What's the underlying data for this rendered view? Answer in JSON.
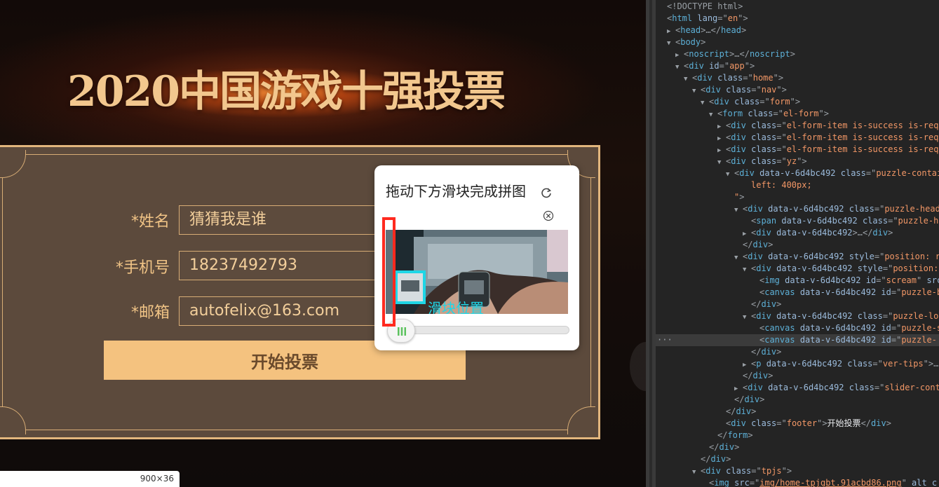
{
  "page": {
    "title": "2020中国游戏十强投票",
    "form": {
      "name_label": "*姓名",
      "name_value": "猜猜我是谁",
      "phone_label": "*手机号",
      "phone_value": "18237492793",
      "email_label": "*邮箱",
      "email_value": "autofelix@163.com",
      "submit_label": "开始投票"
    },
    "size_tip": "900×36"
  },
  "puzzle": {
    "title": "拖动下方滑块完成拼图",
    "slider_label": "滑块位置"
  },
  "devtools": {
    "lines": [
      {
        "indent": 0,
        "tri": "",
        "parts": [
          [
            "tw",
            "<!DOCTYPE html>"
          ]
        ]
      },
      {
        "indent": 0,
        "tri": "",
        "parts": [
          [
            "tw",
            "<"
          ],
          [
            "tg",
            "html"
          ],
          [
            "an",
            " lang"
          ],
          [
            "tw",
            "=\""
          ],
          [
            "av",
            "en"
          ],
          [
            "tw",
            "\">"
          ]
        ]
      },
      {
        "indent": 1,
        "tri": "▶",
        "parts": [
          [
            "tw",
            "<"
          ],
          [
            "tg",
            "head"
          ],
          [
            "tw",
            ">…</"
          ],
          [
            "tg",
            "head"
          ],
          [
            "tw",
            ">"
          ]
        ]
      },
      {
        "indent": 1,
        "tri": "▼",
        "parts": [
          [
            "tw",
            "<"
          ],
          [
            "tg",
            "body"
          ],
          [
            "tw",
            ">"
          ]
        ]
      },
      {
        "indent": 2,
        "tri": "▶",
        "parts": [
          [
            "tw",
            "<"
          ],
          [
            "tg",
            "noscript"
          ],
          [
            "tw",
            ">…</"
          ],
          [
            "tg",
            "noscript"
          ],
          [
            "tw",
            ">"
          ]
        ]
      },
      {
        "indent": 2,
        "tri": "▼",
        "parts": [
          [
            "tw",
            "<"
          ],
          [
            "tg",
            "div"
          ],
          [
            "an",
            " id"
          ],
          [
            "tw",
            "=\""
          ],
          [
            "av",
            "app"
          ],
          [
            "tw",
            "\">"
          ]
        ]
      },
      {
        "indent": 3,
        "tri": "▼",
        "parts": [
          [
            "tw",
            "<"
          ],
          [
            "tg",
            "div"
          ],
          [
            "an",
            " class"
          ],
          [
            "tw",
            "=\""
          ],
          [
            "av",
            "home"
          ],
          [
            "tw",
            "\">"
          ]
        ]
      },
      {
        "indent": 4,
        "tri": "▼",
        "parts": [
          [
            "tw",
            "<"
          ],
          [
            "tg",
            "div"
          ],
          [
            "an",
            " class"
          ],
          [
            "tw",
            "=\""
          ],
          [
            "av",
            "nav"
          ],
          [
            "tw",
            "\">"
          ]
        ]
      },
      {
        "indent": 5,
        "tri": "▼",
        "parts": [
          [
            "tw",
            "<"
          ],
          [
            "tg",
            "div"
          ],
          [
            "an",
            " class"
          ],
          [
            "tw",
            "=\""
          ],
          [
            "av",
            "form"
          ],
          [
            "tw",
            "\">"
          ]
        ]
      },
      {
        "indent": 6,
        "tri": "▼",
        "parts": [
          [
            "tw",
            "<"
          ],
          [
            "tg",
            "form"
          ],
          [
            "an",
            " class"
          ],
          [
            "tw",
            "=\""
          ],
          [
            "av",
            "el-form"
          ],
          [
            "tw",
            "\">"
          ]
        ]
      },
      {
        "indent": 7,
        "tri": "▶",
        "parts": [
          [
            "tw",
            "<"
          ],
          [
            "tg",
            "div"
          ],
          [
            "an",
            " class"
          ],
          [
            "tw",
            "=\""
          ],
          [
            "av",
            "el-form-item is-success is-req"
          ]
        ]
      },
      {
        "indent": 7,
        "tri": "▶",
        "parts": [
          [
            "tw",
            "<"
          ],
          [
            "tg",
            "div"
          ],
          [
            "an",
            " class"
          ],
          [
            "tw",
            "=\""
          ],
          [
            "av",
            "el-form-item is-success is-req"
          ]
        ]
      },
      {
        "indent": 7,
        "tri": "▶",
        "parts": [
          [
            "tw",
            "<"
          ],
          [
            "tg",
            "div"
          ],
          [
            "an",
            " class"
          ],
          [
            "tw",
            "=\""
          ],
          [
            "av",
            "el-form-item is-success is-req"
          ]
        ]
      },
      {
        "indent": 7,
        "tri": "▼",
        "parts": [
          [
            "tw",
            "<"
          ],
          [
            "tg",
            "div"
          ],
          [
            "an",
            " class"
          ],
          [
            "tw",
            "=\""
          ],
          [
            "av",
            "yz"
          ],
          [
            "tw",
            "\">"
          ]
        ]
      },
      {
        "indent": 8,
        "tri": "▼",
        "parts": [
          [
            "tw",
            "<"
          ],
          [
            "tg",
            "div"
          ],
          [
            "an",
            " data-v-6d4bc492 class"
          ],
          [
            "tw",
            "=\""
          ],
          [
            "av",
            "puzzle-contai"
          ]
        ]
      },
      {
        "indent": 10,
        "tri": "",
        "parts": [
          [
            "av",
            "left: 400px;"
          ]
        ]
      },
      {
        "indent": 8,
        "tri": "",
        "parts": [
          [
            "av",
            "\""
          ],
          [
            "tw",
            ">"
          ]
        ]
      },
      {
        "indent": 9,
        "tri": "▼",
        "parts": [
          [
            "tw",
            "<"
          ],
          [
            "tg",
            "div"
          ],
          [
            "an",
            " data-v-6d4bc492 class"
          ],
          [
            "tw",
            "=\""
          ],
          [
            "av",
            "puzzle-head"
          ]
        ]
      },
      {
        "indent": 10,
        "tri": "",
        "parts": [
          [
            "tw",
            "<"
          ],
          [
            "tg",
            "span"
          ],
          [
            "an",
            " data-v-6d4bc492 class"
          ],
          [
            "tw",
            "=\""
          ],
          [
            "av",
            "puzzle-h"
          ]
        ]
      },
      {
        "indent": 10,
        "tri": "▶",
        "parts": [
          [
            "tw",
            "<"
          ],
          [
            "tg",
            "div"
          ],
          [
            "an",
            " data-v-6d4bc492"
          ],
          [
            "tw",
            ">…</"
          ],
          [
            "tg",
            "div"
          ],
          [
            "tw",
            ">"
          ]
        ]
      },
      {
        "indent": 9,
        "tri": "",
        "parts": [
          [
            "tw",
            "</"
          ],
          [
            "tg",
            "div"
          ],
          [
            "tw",
            ">"
          ]
        ]
      },
      {
        "indent": 9,
        "tri": "▼",
        "parts": [
          [
            "tw",
            "<"
          ],
          [
            "tg",
            "div"
          ],
          [
            "an",
            " data-v-6d4bc492 style"
          ],
          [
            "tw",
            "=\""
          ],
          [
            "av",
            "position: r"
          ]
        ]
      },
      {
        "indent": 10,
        "tri": "▼",
        "parts": [
          [
            "tw",
            "<"
          ],
          [
            "tg",
            "div"
          ],
          [
            "an",
            " data-v-6d4bc492 style"
          ],
          [
            "tw",
            "=\""
          ],
          [
            "av",
            "position:"
          ]
        ]
      },
      {
        "indent": 11,
        "tri": "",
        "parts": [
          [
            "tw",
            "<"
          ],
          [
            "tg",
            "img"
          ],
          [
            "an",
            " data-v-6d4bc492 id"
          ],
          [
            "tw",
            "=\""
          ],
          [
            "av",
            "scream"
          ],
          [
            "tw",
            "\""
          ],
          [
            "an",
            " src"
          ]
        ]
      },
      {
        "indent": 11,
        "tri": "",
        "parts": [
          [
            "tw",
            "<"
          ],
          [
            "tg",
            "canvas"
          ],
          [
            "an",
            " data-v-6d4bc492 id"
          ],
          [
            "tw",
            "=\""
          ],
          [
            "av",
            "puzzle-b"
          ]
        ]
      },
      {
        "indent": 10,
        "tri": "",
        "parts": [
          [
            "tw",
            "</"
          ],
          [
            "tg",
            "div"
          ],
          [
            "tw",
            ">"
          ]
        ]
      },
      {
        "indent": 10,
        "tri": "▼",
        "parts": [
          [
            "tw",
            "<"
          ],
          [
            "tg",
            "div"
          ],
          [
            "an",
            " data-v-6d4bc492 class"
          ],
          [
            "tw",
            "=\""
          ],
          [
            "av",
            "puzzle-lo"
          ]
        ]
      },
      {
        "indent": 11,
        "tri": "",
        "parts": [
          [
            "tw",
            "<"
          ],
          [
            "tg",
            "canvas"
          ],
          [
            "an",
            " data-v-6d4bc492 id"
          ],
          [
            "tw",
            "=\""
          ],
          [
            "av",
            "puzzle-s"
          ]
        ]
      },
      {
        "indent": 11,
        "tri": "",
        "parts": [
          [
            "tw",
            "<"
          ],
          [
            "tg",
            "canvas"
          ],
          [
            "an",
            " data-v-6d4bc492 id"
          ],
          [
            "tw",
            "=\""
          ],
          [
            "av",
            "puzzle-"
          ]
        ]
      },
      {
        "indent": 10,
        "tri": "",
        "parts": [
          [
            "tw",
            "</"
          ],
          [
            "tg",
            "div"
          ],
          [
            "tw",
            ">"
          ]
        ]
      },
      {
        "indent": 10,
        "tri": "▶",
        "parts": [
          [
            "tw",
            "<"
          ],
          [
            "tg",
            "p"
          ],
          [
            "an",
            " data-v-6d4bc492 class"
          ],
          [
            "tw",
            "=\""
          ],
          [
            "av",
            "ver-tips"
          ],
          [
            "tw",
            "\">…"
          ]
        ]
      },
      {
        "indent": 9,
        "tri": "",
        "parts": [
          [
            "tw",
            "</"
          ],
          [
            "tg",
            "div"
          ],
          [
            "tw",
            ">"
          ]
        ]
      },
      {
        "indent": 9,
        "tri": "▶",
        "parts": [
          [
            "tw",
            "<"
          ],
          [
            "tg",
            "div"
          ],
          [
            "an",
            " data-v-6d4bc492 class"
          ],
          [
            "tw",
            "=\""
          ],
          [
            "av",
            "slider-cont"
          ]
        ]
      },
      {
        "indent": 8,
        "tri": "",
        "parts": [
          [
            "tw",
            "</"
          ],
          [
            "tg",
            "div"
          ],
          [
            "tw",
            ">"
          ]
        ]
      },
      {
        "indent": 7,
        "tri": "",
        "parts": [
          [
            "tw",
            "</"
          ],
          [
            "tg",
            "div"
          ],
          [
            "tw",
            ">"
          ]
        ]
      },
      {
        "indent": 7,
        "tri": "",
        "parts": [
          [
            "tw",
            "<"
          ],
          [
            "tg",
            "div"
          ],
          [
            "an",
            " class"
          ],
          [
            "tw",
            "=\""
          ],
          [
            "av",
            "footer"
          ],
          [
            "tw",
            "\">"
          ],
          [
            "tx",
            "开始投票"
          ],
          [
            "tw",
            "</"
          ],
          [
            "tg",
            "div"
          ],
          [
            "tw",
            ">"
          ]
        ]
      },
      {
        "indent": 6,
        "tri": "",
        "parts": [
          [
            "tw",
            "</"
          ],
          [
            "tg",
            "form"
          ],
          [
            "tw",
            ">"
          ]
        ]
      },
      {
        "indent": 5,
        "tri": "",
        "parts": [
          [
            "tw",
            "</"
          ],
          [
            "tg",
            "div"
          ],
          [
            "tw",
            ">"
          ]
        ]
      },
      {
        "indent": 4,
        "tri": "",
        "parts": [
          [
            "tw",
            "</"
          ],
          [
            "tg",
            "div"
          ],
          [
            "tw",
            ">"
          ]
        ]
      },
      {
        "indent": 4,
        "tri": "▼",
        "parts": [
          [
            "tw",
            "<"
          ],
          [
            "tg",
            "div"
          ],
          [
            "an",
            " class"
          ],
          [
            "tw",
            "=\""
          ],
          [
            "av",
            "tpjs"
          ],
          [
            "tw",
            "\">"
          ]
        ]
      },
      {
        "indent": 5,
        "tri": "",
        "parts": [
          [
            "tw",
            "<"
          ],
          [
            "tg",
            "img"
          ],
          [
            "an",
            " src"
          ],
          [
            "tw",
            "=\""
          ],
          [
            "lk",
            "img/home-tpjgbt.91acbd86.png"
          ],
          [
            "tw",
            "\""
          ],
          [
            "an",
            " alt c"
          ]
        ]
      }
    ],
    "selected_line": 28,
    "ellipsis": "···"
  },
  "colors": {
    "title_gold": "#f2c78e",
    "frame_bg": "#5c4a3c",
    "button_bg": "#f4c27f",
    "slider_highlight": "#1fd6e6",
    "marker_red": "#ff2a1f"
  }
}
